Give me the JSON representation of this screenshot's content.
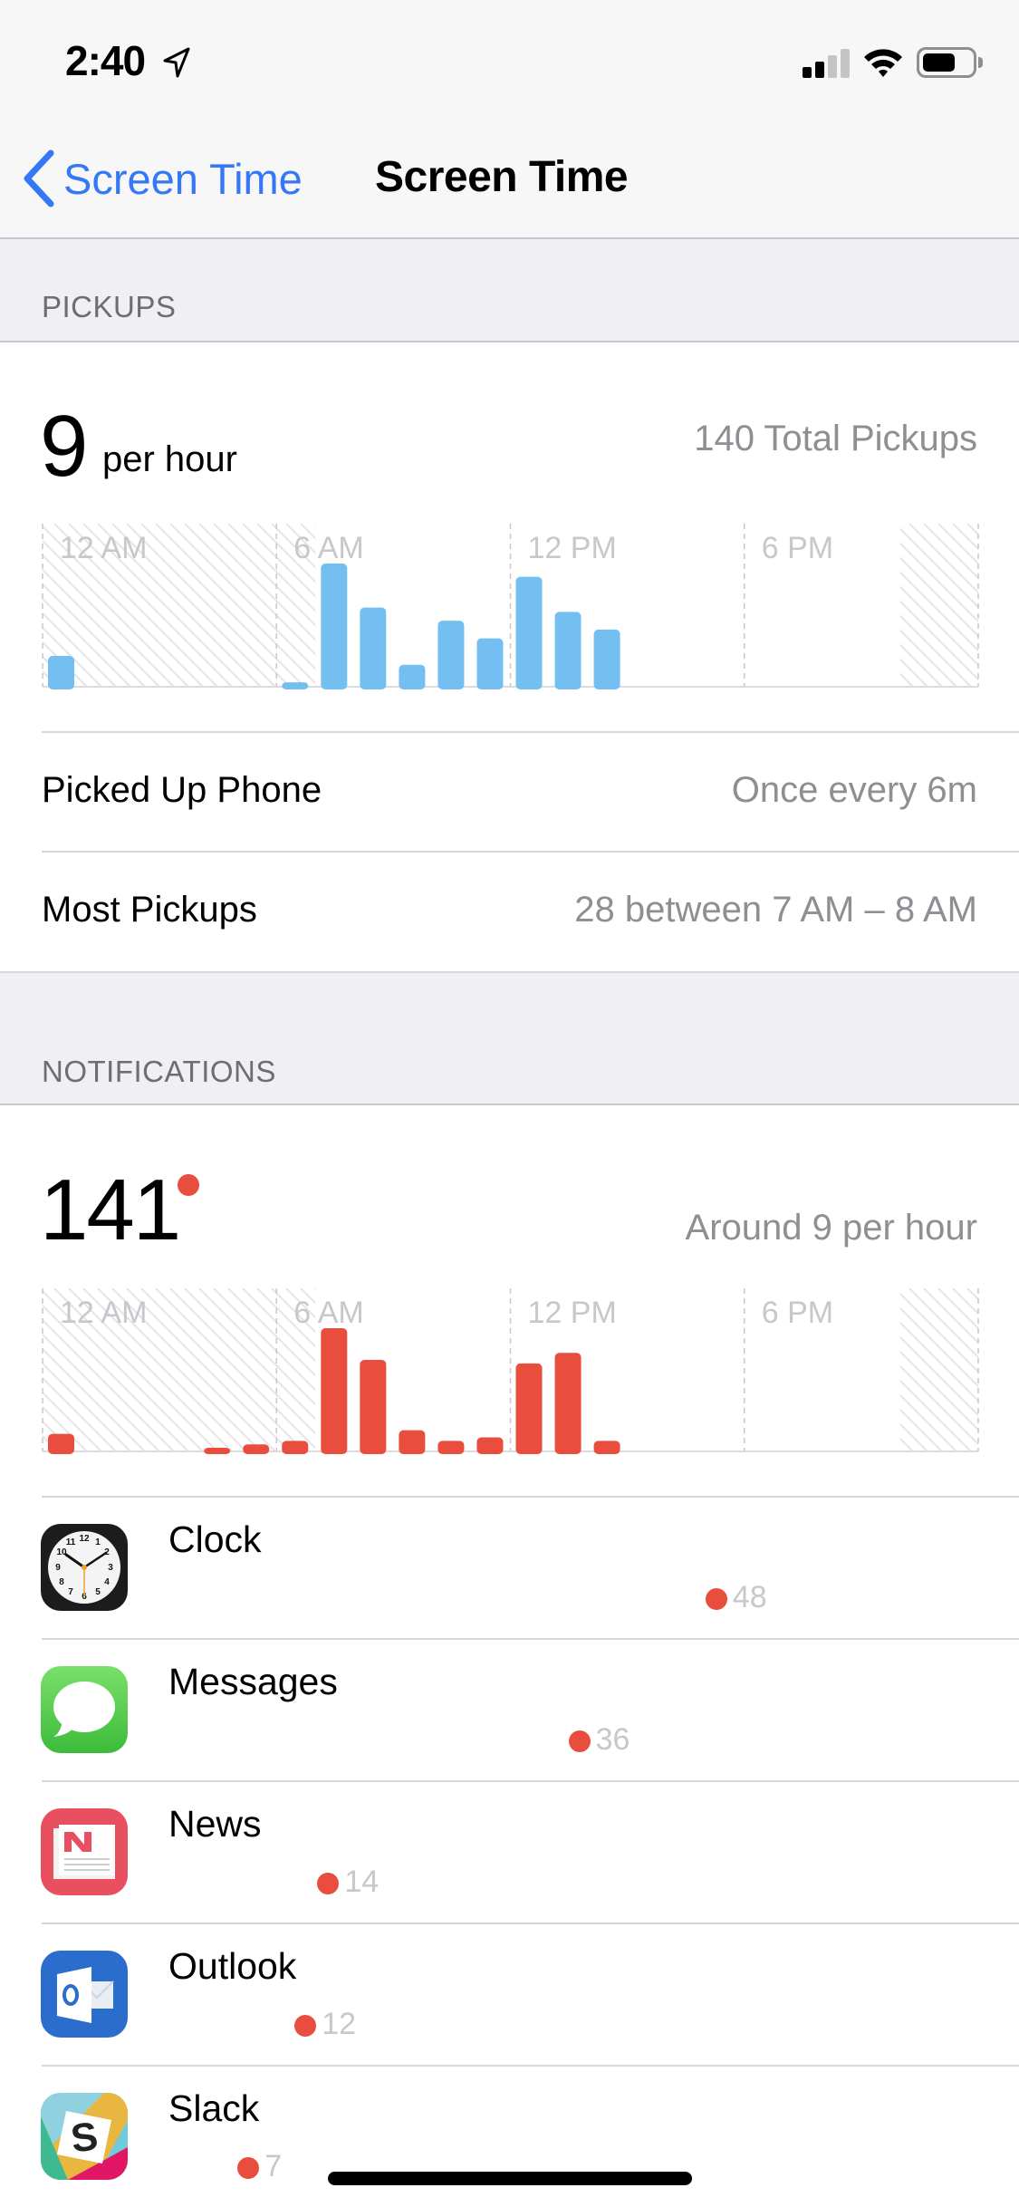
{
  "status_bar": {
    "time": "2:40",
    "location_icon": "location-arrow-icon",
    "signal_bars_active": 2,
    "signal_bars_total": 4,
    "wifi_icon": "wifi-icon",
    "battery_level": 0.65
  },
  "nav": {
    "back_label": "Screen Time",
    "title": "Screen Time"
  },
  "colors": {
    "accent": "#3478f6",
    "pickups_bar": "#74bff2",
    "notifications_bar": "#e84d3d",
    "secondary_text": "#8e8e93",
    "tick_text": "#c7c7cc"
  },
  "pickups": {
    "header": "PICKUPS",
    "rate_value": "9",
    "rate_unit": "per hour",
    "total_label": "140 Total Pickups",
    "rows": [
      {
        "label": "Picked Up Phone",
        "value": "Once every 6m"
      },
      {
        "label": "Most Pickups",
        "value": "28 between 7 AM – 8 AM"
      }
    ]
  },
  "notifications": {
    "header": "NOTIFICATIONS",
    "total": "141",
    "rate_label": "Around 9 per hour",
    "apps": [
      {
        "name": "Clock",
        "icon": "clock-app-icon",
        "count": 48
      },
      {
        "name": "Messages",
        "icon": "messages-app-icon",
        "count": 36
      },
      {
        "name": "News",
        "icon": "news-app-icon",
        "count": 14
      },
      {
        "name": "Outlook",
        "icon": "outlook-app-icon",
        "count": 12
      },
      {
        "name": "Slack",
        "icon": "slack-app-icon",
        "count": 7
      }
    ]
  },
  "chart_data": [
    {
      "type": "bar",
      "title": "Pickups per hour",
      "xlabel": "",
      "ylabel": "",
      "x_range_hours": [
        0,
        24
      ],
      "tick_labels": [
        {
          "hour": 0,
          "label": "12 AM"
        },
        {
          "hour": 6,
          "label": "6 AM"
        },
        {
          "hour": 12,
          "label": "12 PM"
        },
        {
          "hour": 18,
          "label": "6 PM"
        }
      ],
      "downtime_hours": [
        [
          0,
          7
        ],
        [
          22,
          24
        ]
      ],
      "hours": [
        0,
        6,
        7,
        8,
        9,
        10,
        11,
        12,
        13,
        14
      ],
      "values": [
        7,
        1,
        28,
        18,
        5,
        15,
        11,
        25,
        17,
        13
      ],
      "ylim": [
        0,
        28
      ],
      "grid": "dashed vertical at 6-hour intervals",
      "legend": "none"
    },
    {
      "type": "bar",
      "title": "Notifications per hour",
      "xlabel": "",
      "ylabel": "",
      "x_range_hours": [
        0,
        24
      ],
      "tick_labels": [
        {
          "hour": 0,
          "label": "12 AM"
        },
        {
          "hour": 6,
          "label": "6 AM"
        },
        {
          "hour": 12,
          "label": "12 PM"
        },
        {
          "hour": 18,
          "label": "6 PM"
        }
      ],
      "downtime_hours": [
        [
          0,
          7
        ],
        [
          22,
          24
        ]
      ],
      "hours": [
        0,
        4,
        5,
        6,
        7,
        8,
        9,
        10,
        11,
        12,
        13,
        14
      ],
      "values": [
        5,
        1,
        2,
        3,
        35,
        26,
        6,
        3,
        4,
        25,
        28,
        3
      ],
      "ylim": [
        0,
        35
      ],
      "grid": "dashed vertical at 6-hour intervals",
      "legend": "none"
    }
  ]
}
